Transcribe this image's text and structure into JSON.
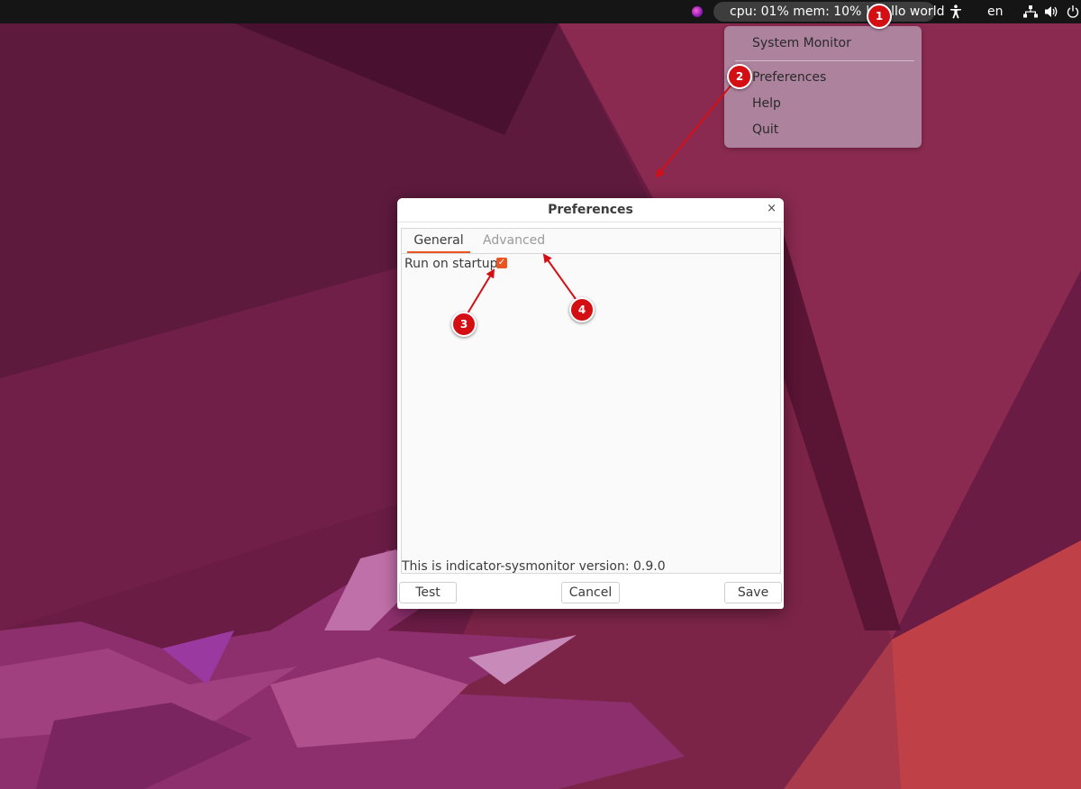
{
  "topbar": {
    "indicator_text": "cpu: 01% mem: 10% | Hello world",
    "language": "en",
    "icons": [
      "app-indicator-icon",
      "accessibility-icon",
      "network-icon",
      "volume-icon",
      "power-icon"
    ]
  },
  "menu": {
    "items": [
      {
        "label": "System Monitor"
      },
      {
        "label": "Preferences"
      },
      {
        "label": "Help"
      },
      {
        "label": "Quit"
      }
    ]
  },
  "dialog": {
    "title": "Preferences",
    "close_glyph": "×",
    "tabs": [
      {
        "label": "General",
        "active": true
      },
      {
        "label": "Advanced",
        "active": false
      }
    ],
    "run_on_startup_label": "Run on startup:",
    "run_on_startup_checked": true,
    "version_text": "This is indicator-sysmonitor version: 0.9.0",
    "buttons": {
      "test": "Test",
      "cancel": "Cancel",
      "save": "Save"
    }
  },
  "annotations": {
    "markers": [
      "1",
      "2",
      "3",
      "4"
    ],
    "color": "#d40f14"
  },
  "colors": {
    "accent": "#e95420",
    "topbar": "#151515",
    "wallpaper_base": "#5a1738"
  }
}
